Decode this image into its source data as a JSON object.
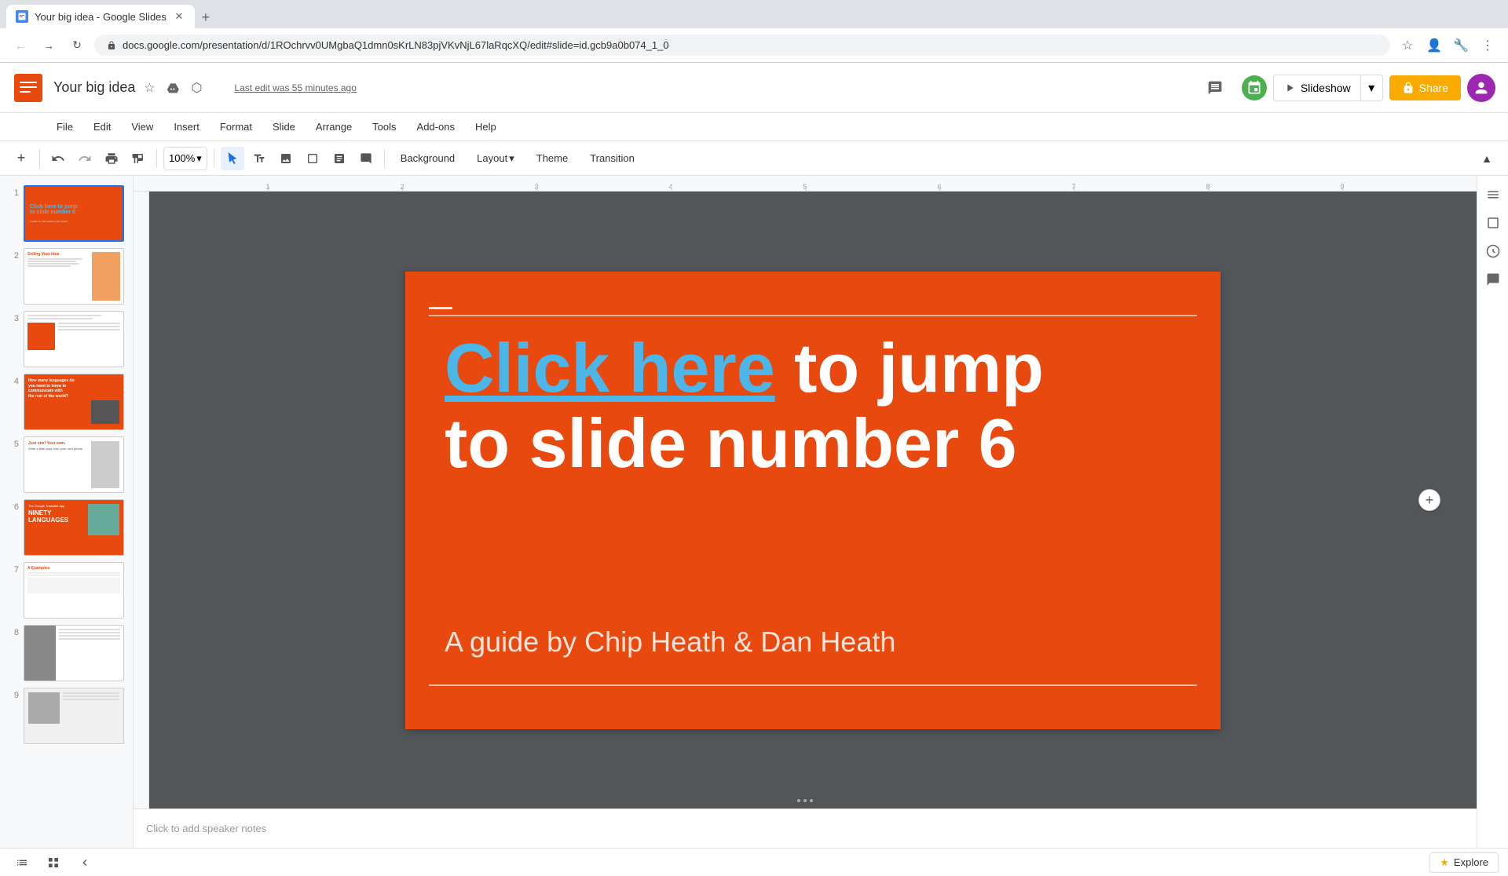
{
  "browser": {
    "tab_title": "Your big idea - Google Slides",
    "url": "docs.google.com/presentation/d/1ROchrvv0UMgbaQ1dmn0sKrLN83pjVKvNjL67laRqcXQ/edit#slide=id.gcb9a0b074_1_0",
    "new_tab_label": "+"
  },
  "app": {
    "title": "Your big idea",
    "last_edit": "Last edit was 55 minutes ago",
    "logo_color": "#e8490f"
  },
  "menu": {
    "items": [
      "File",
      "Edit",
      "View",
      "Insert",
      "Format",
      "Slide",
      "Arrange",
      "Tools",
      "Add-ons",
      "Help"
    ]
  },
  "toolbar": {
    "zoom": "100%",
    "background_label": "Background",
    "layout_label": "Layout",
    "theme_label": "Theme",
    "transition_label": "Transition"
  },
  "slideshow_btn": "Slideshow",
  "share_btn": "Share",
  "slides": [
    {
      "num": "1",
      "active": true
    },
    {
      "num": "2",
      "active": false
    },
    {
      "num": "3",
      "active": false
    },
    {
      "num": "4",
      "active": false
    },
    {
      "num": "5",
      "active": false
    },
    {
      "num": "6",
      "active": false
    },
    {
      "num": "7",
      "active": false
    },
    {
      "num": "8",
      "active": false
    },
    {
      "num": "9",
      "active": false
    }
  ],
  "slide_content": {
    "click_here_text": "Click here",
    "main_text": " to jump",
    "second_line": "to slide number 6",
    "subtitle": "A guide by Chip Heath & Dan Heath"
  },
  "notes": {
    "placeholder": "Click to add speaker notes"
  },
  "bottom_bar": {
    "explore_label": "Explore"
  },
  "ruler_marks": [
    "1",
    "2",
    "3",
    "4",
    "5",
    "6",
    "7",
    "8",
    "9"
  ]
}
